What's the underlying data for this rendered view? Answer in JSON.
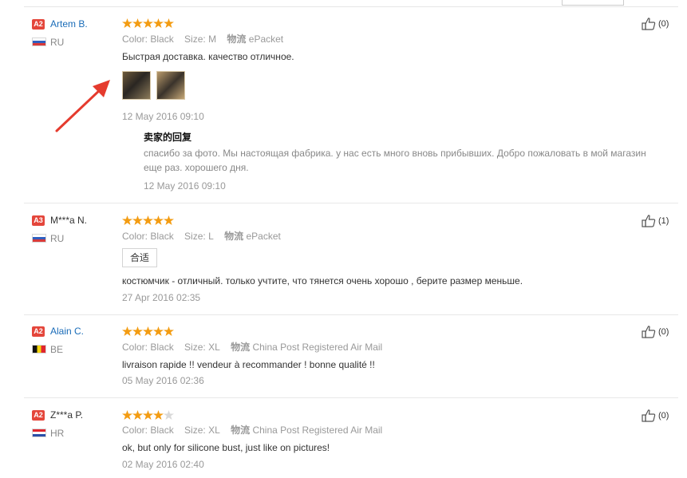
{
  "reviews": [
    {
      "level": "A2",
      "name": "Artem B.",
      "country": "RU",
      "stars": 5,
      "color_label": "Color:",
      "color_value": "Black",
      "size_label": "Size:",
      "size_value": "M",
      "logistics_label": "物流",
      "logistics_value": "ePacket",
      "text": "Быстрая доставка. качество отличное.",
      "date": "12 May 2016 09:10",
      "likes": "(0)",
      "reply": {
        "title": "卖家的回复",
        "text": "спасибо за фото. Мы настоящая фабрика. у нас есть много вновь прибывших. Добро пожаловать в мой магазин еще раз. хорошего дня.",
        "date": "12 May 2016 09:10"
      }
    },
    {
      "level": "A3",
      "name": "M***a N.",
      "country": "RU",
      "stars": 5,
      "color_label": "Color:",
      "color_value": "Black",
      "size_label": "Size:",
      "size_value": "L",
      "logistics_label": "物流",
      "logistics_value": "ePacket",
      "tag": "合适",
      "text": "костюмчик - отличный. только учтите, что тянется очень хорошо , берите размер меньше.",
      "date": "27 Apr 2016 02:35",
      "likes": "(1)"
    },
    {
      "level": "A2",
      "name": "Alain C.",
      "country": "BE",
      "stars": 5,
      "color_label": "Color:",
      "color_value": "Black",
      "size_label": "Size:",
      "size_value": "XL",
      "logistics_label": "物流",
      "logistics_value": "China Post Registered Air Mail",
      "text": "livraison rapide !! vendeur à recommander ! bonne qualité !!",
      "date": "05 May 2016 02:36",
      "likes": "(0)"
    },
    {
      "level": "A2",
      "name": "Z***a P.",
      "country": "HR",
      "stars": 4,
      "color_label": "Color:",
      "color_value": "Black",
      "size_label": "Size:",
      "size_value": "XL",
      "logistics_label": "物流",
      "logistics_value": "China Post Registered Air Mail",
      "text": "ok, but only for silicone bust, just like on pictures!",
      "date": "02 May 2016 02:40",
      "likes": "(0)"
    }
  ],
  "colors": {
    "level_badge": "#e4463b",
    "name_link": "#1a6cb8",
    "star": "#f39c12",
    "arrow": "#e53b2e"
  }
}
